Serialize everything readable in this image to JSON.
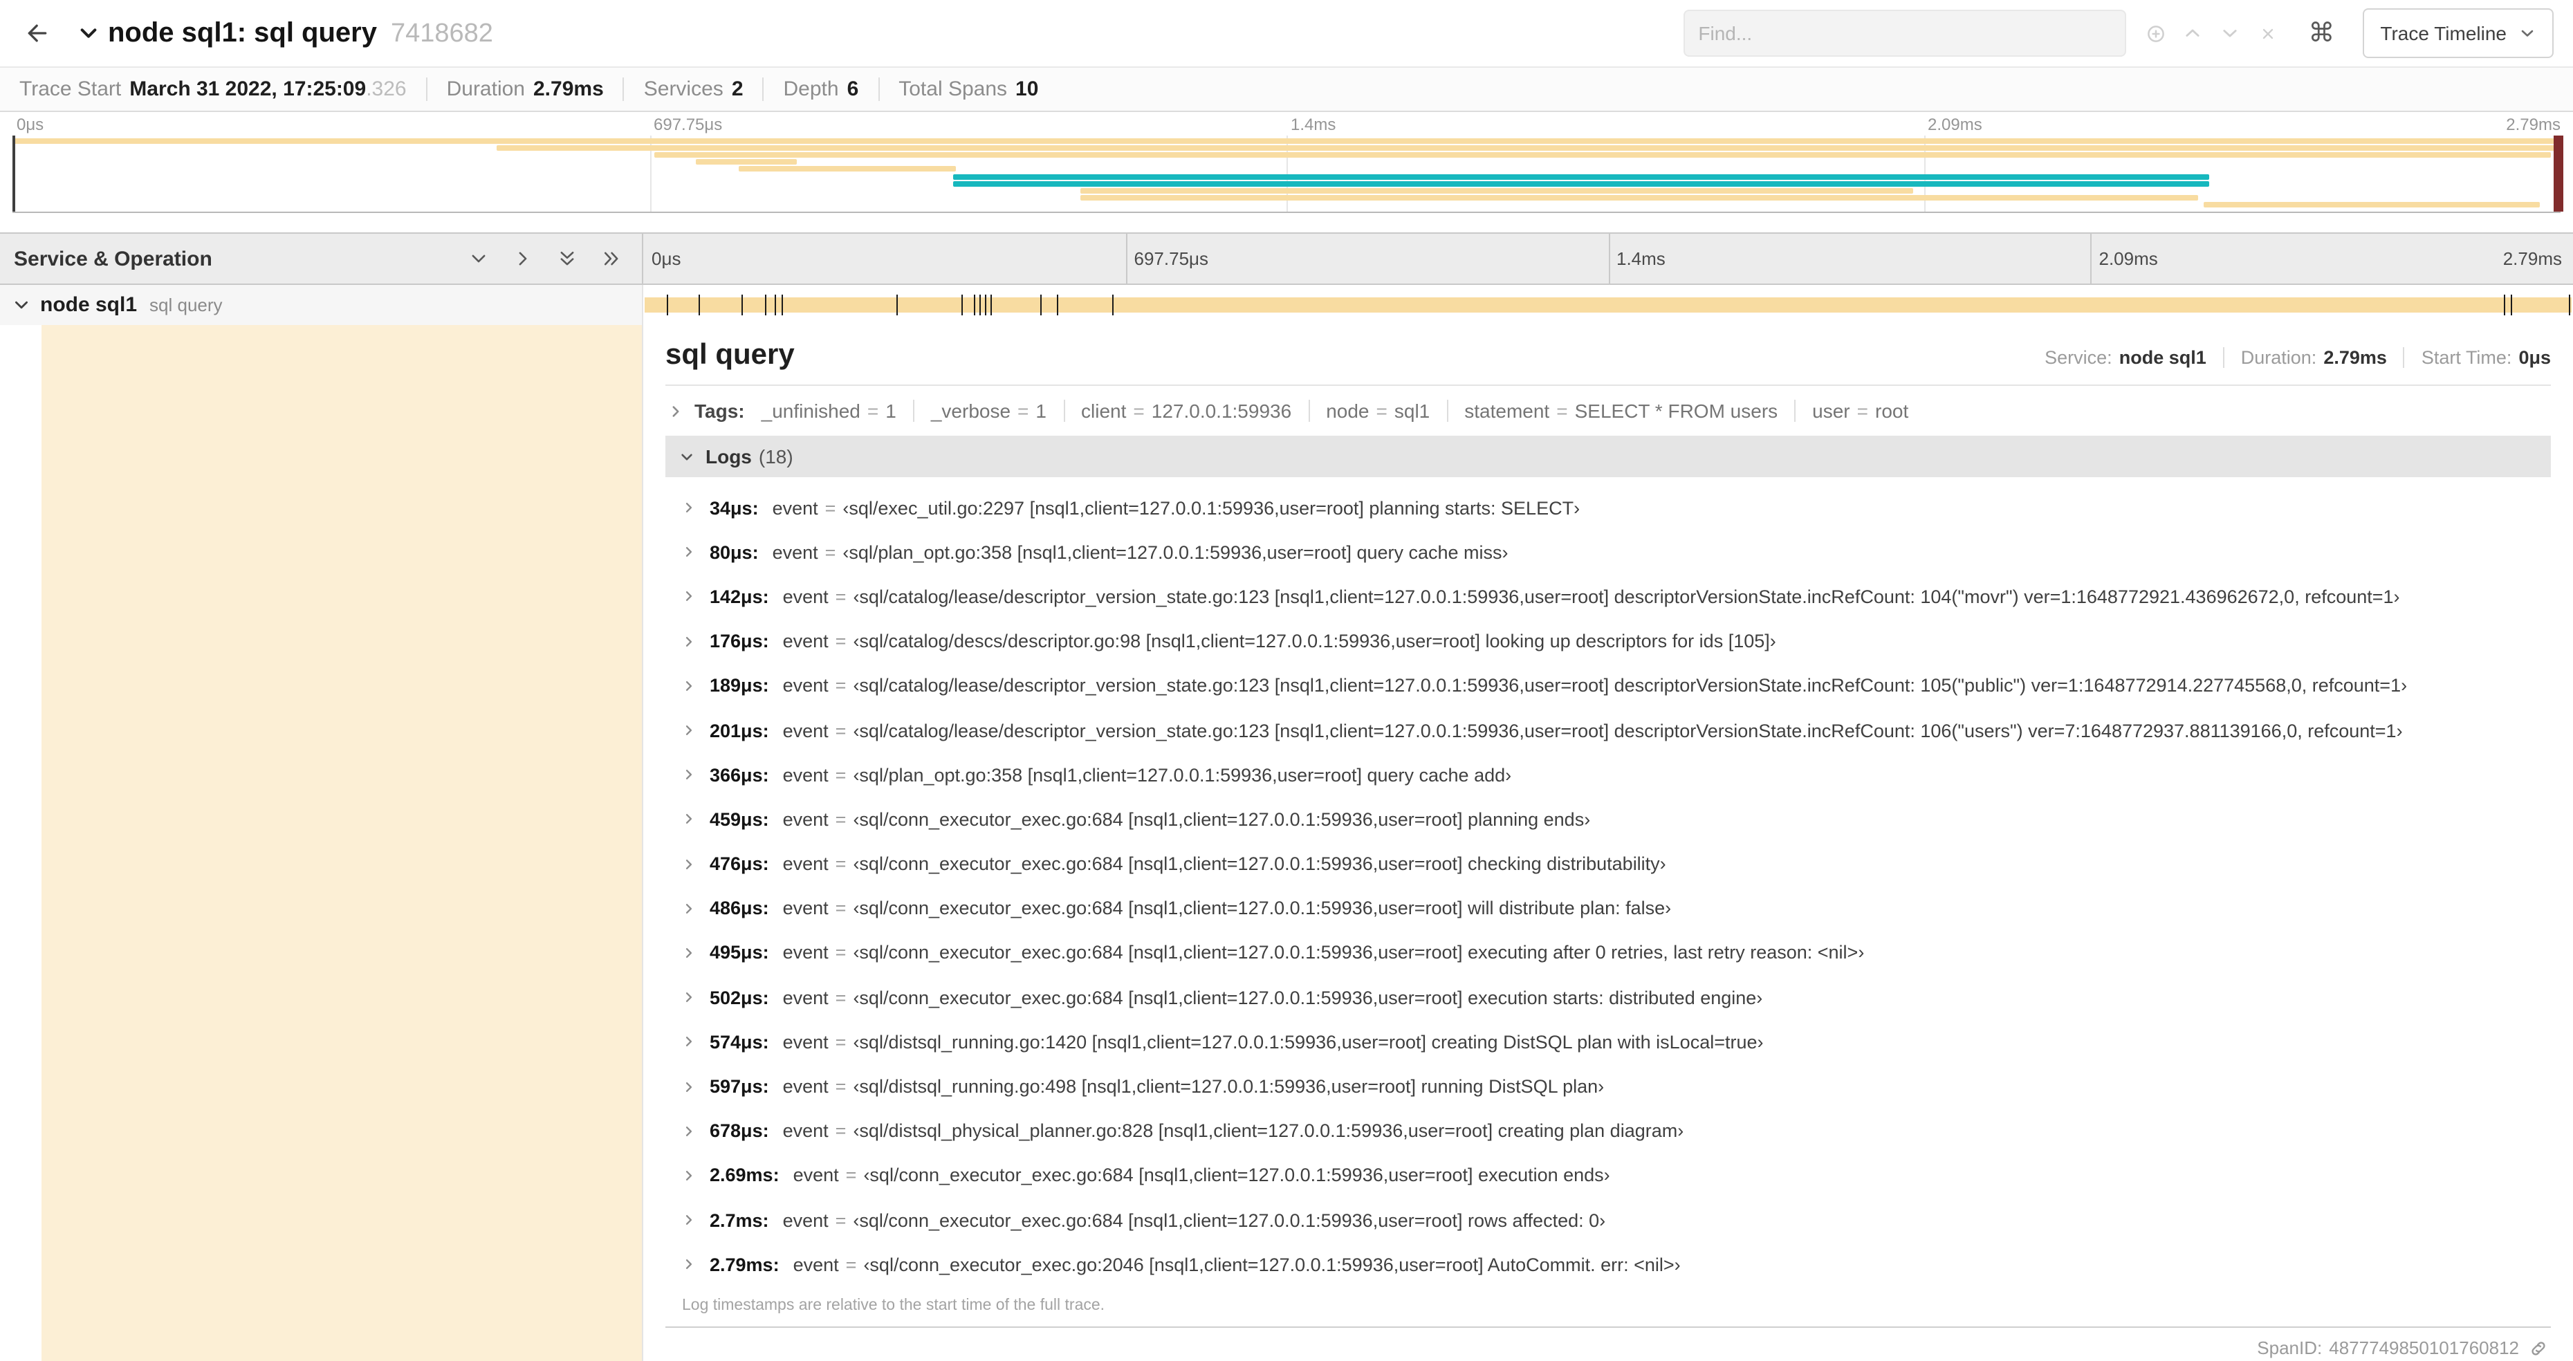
{
  "header": {
    "title": "node sql1: sql query",
    "trace_id": "7418682",
    "find_placeholder": "Find...",
    "shortcuts_icon": "⌘",
    "view_selector_label": "Trace Timeline"
  },
  "trace_summary": {
    "items": [
      {
        "label": "Trace Start",
        "value": "March 31 2022, 17:25:09",
        "suffix": ".326"
      },
      {
        "label": "Duration",
        "value": "2.79ms",
        "suffix": ""
      },
      {
        "label": "Services",
        "value": "2",
        "suffix": ""
      },
      {
        "label": "Depth",
        "value": "6",
        "suffix": ""
      },
      {
        "label": "Total Spans",
        "value": "10",
        "suffix": ""
      }
    ]
  },
  "axis_grid": [
    {
      "x": 25
    },
    {
      "x": 50
    },
    {
      "x": 75
    }
  ],
  "minimap": {
    "axis_labels": [
      {
        "text": "0μs",
        "x": 0
      },
      {
        "text": "697.75μs",
        "x": 25
      },
      {
        "text": "1.4ms",
        "x": 50
      },
      {
        "text": "2.09ms",
        "x": 75
      }
    ],
    "end_label": "2.79ms",
    "spans": [
      {
        "start": 0,
        "width": 100,
        "color": "#f8dca1"
      },
      {
        "start": 19,
        "width": 81,
        "color": "#f8dca1"
      },
      {
        "start": 25.2,
        "width": 74.4,
        "color": "#f8dca1"
      },
      {
        "start": 26.8,
        "width": 4,
        "color": "#f8dca1"
      },
      {
        "start": 28.5,
        "width": 8.5,
        "color": "#f8dca1"
      },
      {
        "start": 36.9,
        "width": 49.3,
        "color": "#17b8be"
      },
      {
        "start": 36.9,
        "width": 49.3,
        "color": "#17b8be"
      },
      {
        "start": 41.9,
        "width": 32.7,
        "color": "#f8dca1"
      },
      {
        "start": 41.9,
        "width": 43.9,
        "color": "#f8dca1"
      },
      {
        "start": 86,
        "width": 13.2,
        "color": "#f8dca1"
      }
    ]
  },
  "timeline_header": {
    "title": "Service & Operation",
    "axis_labels": [
      {
        "text": "0μs",
        "x": 0
      },
      {
        "text": "697.75μs",
        "x": 25
      },
      {
        "text": "1.4ms",
        "x": 50
      },
      {
        "text": "2.09ms",
        "x": 75
      }
    ],
    "end_label": "2.79ms"
  },
  "span_row": {
    "service": "node sql1",
    "operation": "sql query",
    "ticks": [
      {
        "x": 1.2
      },
      {
        "x": 2.9
      },
      {
        "x": 5.1
      },
      {
        "x": 6.3
      },
      {
        "x": 6.8
      },
      {
        "x": 7.2
      },
      {
        "x": 13.1
      },
      {
        "x": 16.5
      },
      {
        "x": 17.1
      },
      {
        "x": 17.4
      },
      {
        "x": 17.7
      },
      {
        "x": 18
      },
      {
        "x": 20.6
      },
      {
        "x": 21.4
      },
      {
        "x": 24.3
      },
      {
        "x": 96.4
      },
      {
        "x": 96.8
      },
      {
        "x": 99.8
      }
    ]
  },
  "detail": {
    "title": "sql query",
    "meta": [
      {
        "label": "Service:",
        "value": "node sql1"
      },
      {
        "label": "Duration:",
        "value": "2.79ms"
      },
      {
        "label": "Start Time:",
        "value": "0μs"
      }
    ],
    "tags_label": "Tags:",
    "tags": [
      {
        "key": "_unfinished",
        "value": "1"
      },
      {
        "key": "_verbose",
        "value": "1"
      },
      {
        "key": "client",
        "value": "127.0.0.1:59936"
      },
      {
        "key": "node",
        "value": "sql1"
      },
      {
        "key": "statement",
        "value": "SELECT * FROM users"
      },
      {
        "key": "user",
        "value": "root"
      }
    ],
    "logs_label": "Logs",
    "logs_count": "(18)",
    "logs": [
      {
        "time": "34μs:",
        "key": "event",
        "value": "‹sql/exec_util.go:2297 [nsql1,client=127.0.0.1:59936,user=root] planning starts: SELECT›"
      },
      {
        "time": "80μs:",
        "key": "event",
        "value": "‹sql/plan_opt.go:358 [nsql1,client=127.0.0.1:59936,user=root] query cache miss›"
      },
      {
        "time": "142μs:",
        "key": "event",
        "value": "‹sql/catalog/lease/descriptor_version_state.go:123 [nsql1,client=127.0.0.1:59936,user=root] descriptorVersionState.incRefCount: 104(\"movr\") ver=1:1648772921.436962672,0, refcount=1›"
      },
      {
        "time": "176μs:",
        "key": "event",
        "value": "‹sql/catalog/descs/descriptor.go:98 [nsql1,client=127.0.0.1:59936,user=root] looking up descriptors for ids [105]›"
      },
      {
        "time": "189μs:",
        "key": "event",
        "value": "‹sql/catalog/lease/descriptor_version_state.go:123 [nsql1,client=127.0.0.1:59936,user=root] descriptorVersionState.incRefCount: 105(\"public\") ver=1:1648772914.227745568,0, refcount=1›"
      },
      {
        "time": "201μs:",
        "key": "event",
        "value": "‹sql/catalog/lease/descriptor_version_state.go:123 [nsql1,client=127.0.0.1:59936,user=root] descriptorVersionState.incRefCount: 106(\"users\") ver=7:1648772937.881139166,0, refcount=1›"
      },
      {
        "time": "366μs:",
        "key": "event",
        "value": "‹sql/plan_opt.go:358 [nsql1,client=127.0.0.1:59936,user=root] query cache add›"
      },
      {
        "time": "459μs:",
        "key": "event",
        "value": "‹sql/conn_executor_exec.go:684 [nsql1,client=127.0.0.1:59936,user=root] planning ends›"
      },
      {
        "time": "476μs:",
        "key": "event",
        "value": "‹sql/conn_executor_exec.go:684 [nsql1,client=127.0.0.1:59936,user=root] checking distributability›"
      },
      {
        "time": "486μs:",
        "key": "event",
        "value": "‹sql/conn_executor_exec.go:684 [nsql1,client=127.0.0.1:59936,user=root] will distribute plan: false›"
      },
      {
        "time": "495μs:",
        "key": "event",
        "value": "‹sql/conn_executor_exec.go:684 [nsql1,client=127.0.0.1:59936,user=root] executing after 0 retries, last retry reason: <nil>›"
      },
      {
        "time": "502μs:",
        "key": "event",
        "value": "‹sql/conn_executor_exec.go:684 [nsql1,client=127.0.0.1:59936,user=root] execution starts: distributed engine›"
      },
      {
        "time": "574μs:",
        "key": "event",
        "value": "‹sql/distsql_running.go:1420 [nsql1,client=127.0.0.1:59936,user=root] creating DistSQL plan with isLocal=true›"
      },
      {
        "time": "597μs:",
        "key": "event",
        "value": "‹sql/distsql_running.go:498 [nsql1,client=127.0.0.1:59936,user=root] running DistSQL plan›"
      },
      {
        "time": "678μs:",
        "key": "event",
        "value": "‹sql/distsql_physical_planner.go:828 [nsql1,client=127.0.0.1:59936,user=root] creating plan diagram›"
      },
      {
        "time": "2.69ms:",
        "key": "event",
        "value": "‹sql/conn_executor_exec.go:684 [nsql1,client=127.0.0.1:59936,user=root] execution ends›"
      },
      {
        "time": "2.7ms:",
        "key": "event",
        "value": "‹sql/conn_executor_exec.go:684 [nsql1,client=127.0.0.1:59936,user=root] rows affected: 0›"
      },
      {
        "time": "2.79ms:",
        "key": "event",
        "value": "‹sql/conn_executor_exec.go:2046 [nsql1,client=127.0.0.1:59936,user=root] AutoCommit. err: <nil>›"
      }
    ],
    "logs_footnote": "Log timestamps are relative to the start time of the full trace.",
    "span_id_label": "SpanID:",
    "span_id": "4877749850101760812"
  },
  "misc": {
    "eq": "="
  },
  "colors": {
    "span_tan": "#f8dca1",
    "span_teal": "#17b8be",
    "scrubber_red": "#812c2c"
  }
}
